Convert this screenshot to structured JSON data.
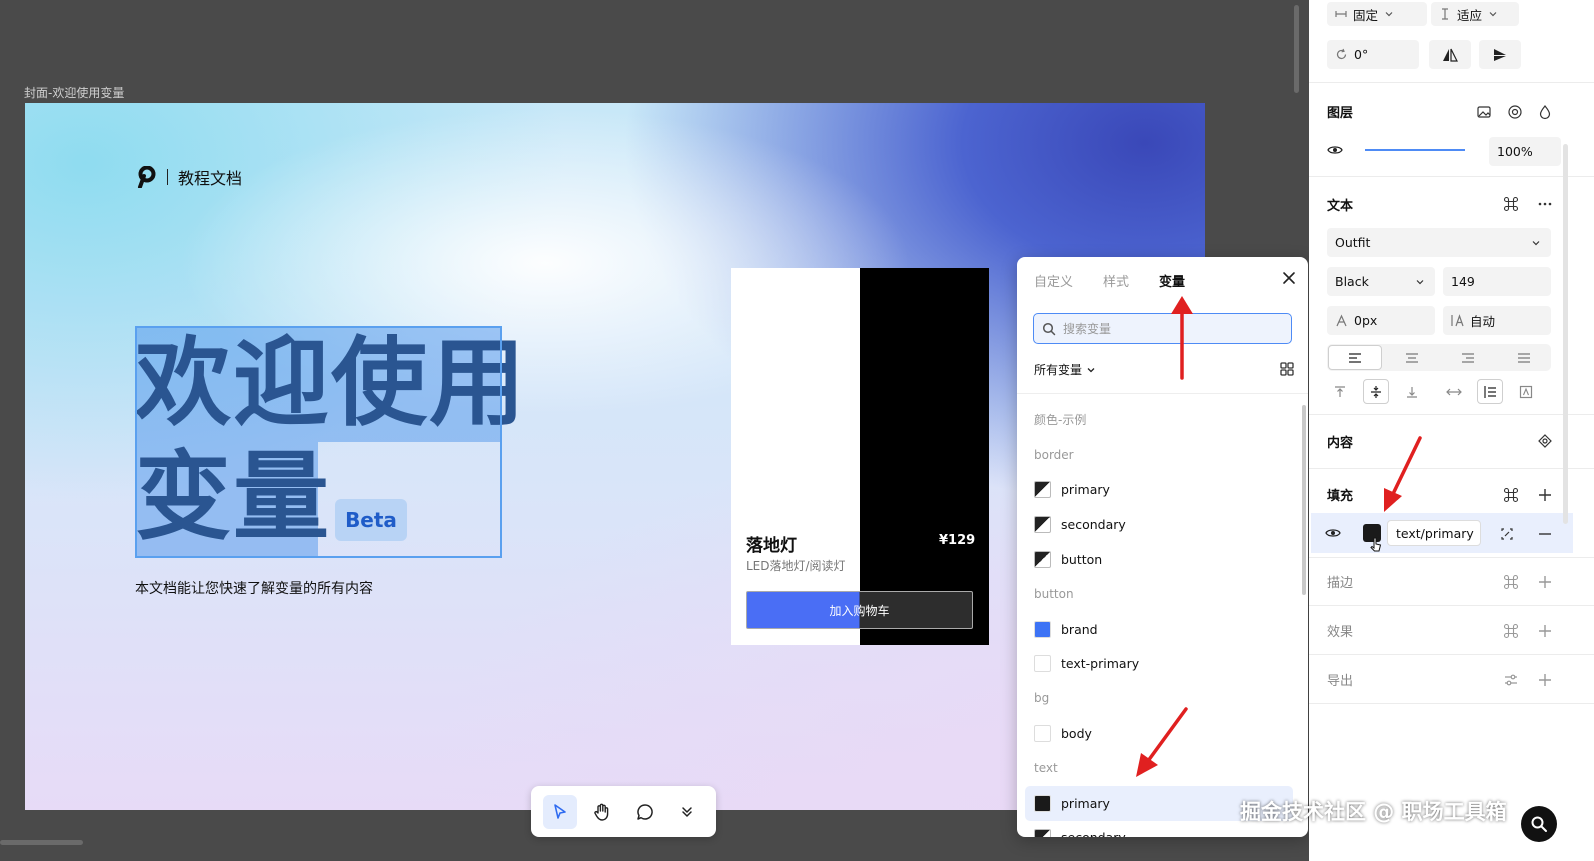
{
  "canvas": {
    "frame_label": "封面-欢迎使用变量",
    "logo_text": "教程文档",
    "headline_line1": "欢迎使用",
    "headline_line2": "变量",
    "beta_badge": "Beta",
    "subtitle": "本文档能让您快速了解变量的所有内容",
    "product": {
      "name": "落地灯",
      "price": "¥129",
      "description": "LED落地灯/阅读灯",
      "cart_button": "加入购物车"
    }
  },
  "toolbar": {
    "tools": [
      "select-tool",
      "hand-tool",
      "comment-tool",
      "more-tools"
    ]
  },
  "variables_popover": {
    "tabs": [
      "自定义",
      "样式",
      "变量"
    ],
    "active_tab": "变量",
    "search_placeholder": "搜索变量",
    "filter_label": "所有变量",
    "groups": [
      {
        "name": "颜色-示例",
        "items": []
      },
      {
        "name": "border",
        "items": [
          {
            "label": "primary",
            "swatch": "diag"
          },
          {
            "label": "secondary",
            "swatch": "diag"
          },
          {
            "label": "button",
            "swatch": "diag"
          }
        ]
      },
      {
        "name": "button",
        "items": [
          {
            "label": "brand",
            "swatch": "#3d73f5"
          },
          {
            "label": "text-primary",
            "swatch": "#ffffff"
          }
        ]
      },
      {
        "name": "bg",
        "items": [
          {
            "label": "body",
            "swatch": "#ffffff"
          }
        ]
      },
      {
        "name": "text",
        "items": [
          {
            "label": "primary",
            "swatch": "#1a1a1a",
            "selected": true
          },
          {
            "label": "secondary",
            "swatch": "diag"
          }
        ]
      }
    ]
  },
  "panel": {
    "size_w_mode": "固定",
    "size_h_mode": "适应",
    "rotation": "0°",
    "layer_title": "图层",
    "opacity": "100%",
    "text_title": "文本",
    "font_family": "Outfit",
    "font_weight": "Black",
    "font_size": "149",
    "letter_spacing": "0px",
    "line_height": "自动",
    "content_title": "内容",
    "fill_title": "填充",
    "fill_variable": "text/primary",
    "fill_color": "#1a1a1a",
    "stroke_title": "描边",
    "effect_title": "效果",
    "export_title": "导出"
  },
  "watermark": "掘金技术社区 @ 职场工具箱",
  "colors": {
    "accent": "#4e8bf5",
    "arrow": "#e02020",
    "headline": "#2a5591"
  }
}
